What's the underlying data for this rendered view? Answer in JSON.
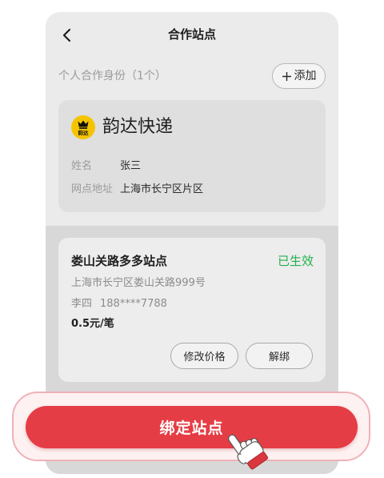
{
  "header": {
    "back_icon": "chevron-left-icon",
    "title": "合作站点"
  },
  "identity_section": {
    "label": "个人合作身份（1个）",
    "add_button": {
      "icon": "plus-icon",
      "label": "添加"
    }
  },
  "courier_card": {
    "logo_icon": "yunda-logo-icon",
    "logo_text": "韵达",
    "company": "韵达快递",
    "fields": [
      {
        "label": "姓名",
        "value": "张三"
      },
      {
        "label": "网点地址",
        "value": "上海市长宁区片区"
      }
    ]
  },
  "station_card": {
    "name": "娄山关路多多站点",
    "status": "已生效",
    "address": "上海市长宁区娄山关路999号",
    "contact_name": "李四",
    "contact_phone": "188****7788",
    "price": "0.5元/笔",
    "actions": {
      "edit_price": "修改价格",
      "unbind": "解绑"
    }
  },
  "bind_button": {
    "label": "绑定站点",
    "cursor_icon": "hand-pointer-icon"
  },
  "colors": {
    "primary_red": "#e53d45",
    "status_green": "#22b04b",
    "logo_yellow": "#f5c400",
    "highlight_border": "#efb2b7"
  }
}
